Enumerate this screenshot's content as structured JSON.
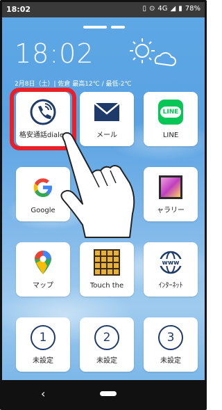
{
  "status": {
    "time": "18:02",
    "network": "4G",
    "battery": "78%"
  },
  "home": {
    "clock": "18:02",
    "date_weather": "2月8日（土）| 佐倉 最高12℃ / 最低-2℃"
  },
  "apps": [
    {
      "label": "格安通話dialer",
      "icon": "phone-call-icon"
    },
    {
      "label": "メール",
      "icon": "envelope-icon"
    },
    {
      "label": "LINE",
      "icon": "line-logo-icon",
      "icon_text": "LINE",
      "color": "#06c755"
    },
    {
      "label": "Google",
      "icon": "google-logo-icon"
    },
    {
      "label": "",
      "icon": "hidden-app-icon"
    },
    {
      "label": "ャラリー",
      "icon": "gallery-icon"
    },
    {
      "label": "マップ",
      "icon": "maps-pin-icon"
    },
    {
      "label": "Touch the",
      "icon": "touch-the-numbers-icon"
    },
    {
      "label": "ｲﾝﾀｰﾈｯﾄ",
      "icon": "www-globe-icon",
      "icon_text": "www"
    },
    {
      "label": "未設定",
      "icon": "number-1-icon",
      "icon_text": "1"
    },
    {
      "label": "未設定",
      "icon": "number-2-icon",
      "icon_text": "2"
    },
    {
      "label": "未設定",
      "icon": "number-3-icon",
      "icon_text": "3"
    }
  ],
  "nav": {
    "back": "‹"
  },
  "colors": {
    "highlight": "#e8202a",
    "line_green": "#06c755"
  }
}
